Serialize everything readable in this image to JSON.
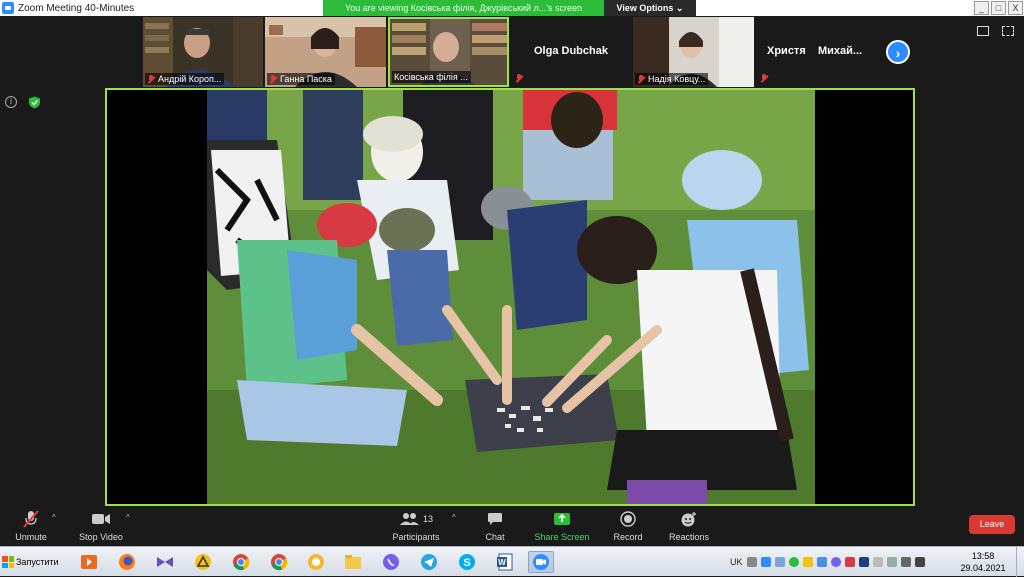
{
  "window": {
    "title": "Zoom Meeting 40-Minutes",
    "buttons": [
      "_",
      "□",
      "X"
    ]
  },
  "share_banner": "You are viewing Косівська філія, Джурівський л...'s screen",
  "view_options": "View Options",
  "participants_tiles": [
    {
      "name": "Андрій Короп...",
      "muted": true
    },
    {
      "name": "Ганна Паска",
      "muted": true
    },
    {
      "name": "Косівська філія ...",
      "muted": false
    },
    {
      "name": "Olga Dubchak",
      "muted": true
    },
    {
      "name": "Надія Ковцу...",
      "muted": true
    },
    {
      "name": "Христя",
      "muted": true
    },
    {
      "name": "Михай...",
      "muted": false
    }
  ],
  "toolbar": {
    "unmute": "Unmute",
    "stop_video": "Stop Video",
    "participants": "Participants",
    "participants_count": "13",
    "chat": "Chat",
    "share_screen": "Share Screen",
    "record": "Record",
    "reactions": "Reactions",
    "leave": "Leave"
  },
  "taskbar": {
    "start": "Запустити",
    "language": "UK",
    "time": "13:58",
    "date": "29.04.2021"
  },
  "colors": {
    "zoom_blue": "#2d8cff",
    "share_green": "#2dbb3a",
    "share_border": "#9ee04a",
    "leave_red": "#d83a33",
    "mute_red": "#e0383e"
  }
}
